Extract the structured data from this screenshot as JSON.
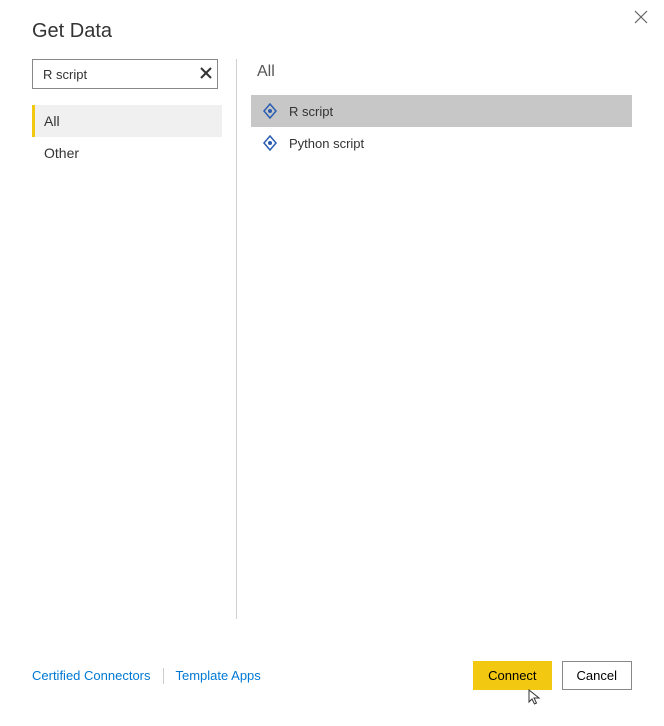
{
  "header": {
    "title": "Get Data"
  },
  "search": {
    "value": "R script"
  },
  "categories": [
    {
      "label": "All",
      "selected": true
    },
    {
      "label": "Other",
      "selected": false
    }
  ],
  "right_header": "All",
  "connectors": [
    {
      "label": "R script",
      "selected": true
    },
    {
      "label": "Python script",
      "selected": false
    }
  ],
  "footer": {
    "certified": "Certified Connectors",
    "templates": "Template Apps",
    "connect": "Connect",
    "cancel": "Cancel"
  }
}
